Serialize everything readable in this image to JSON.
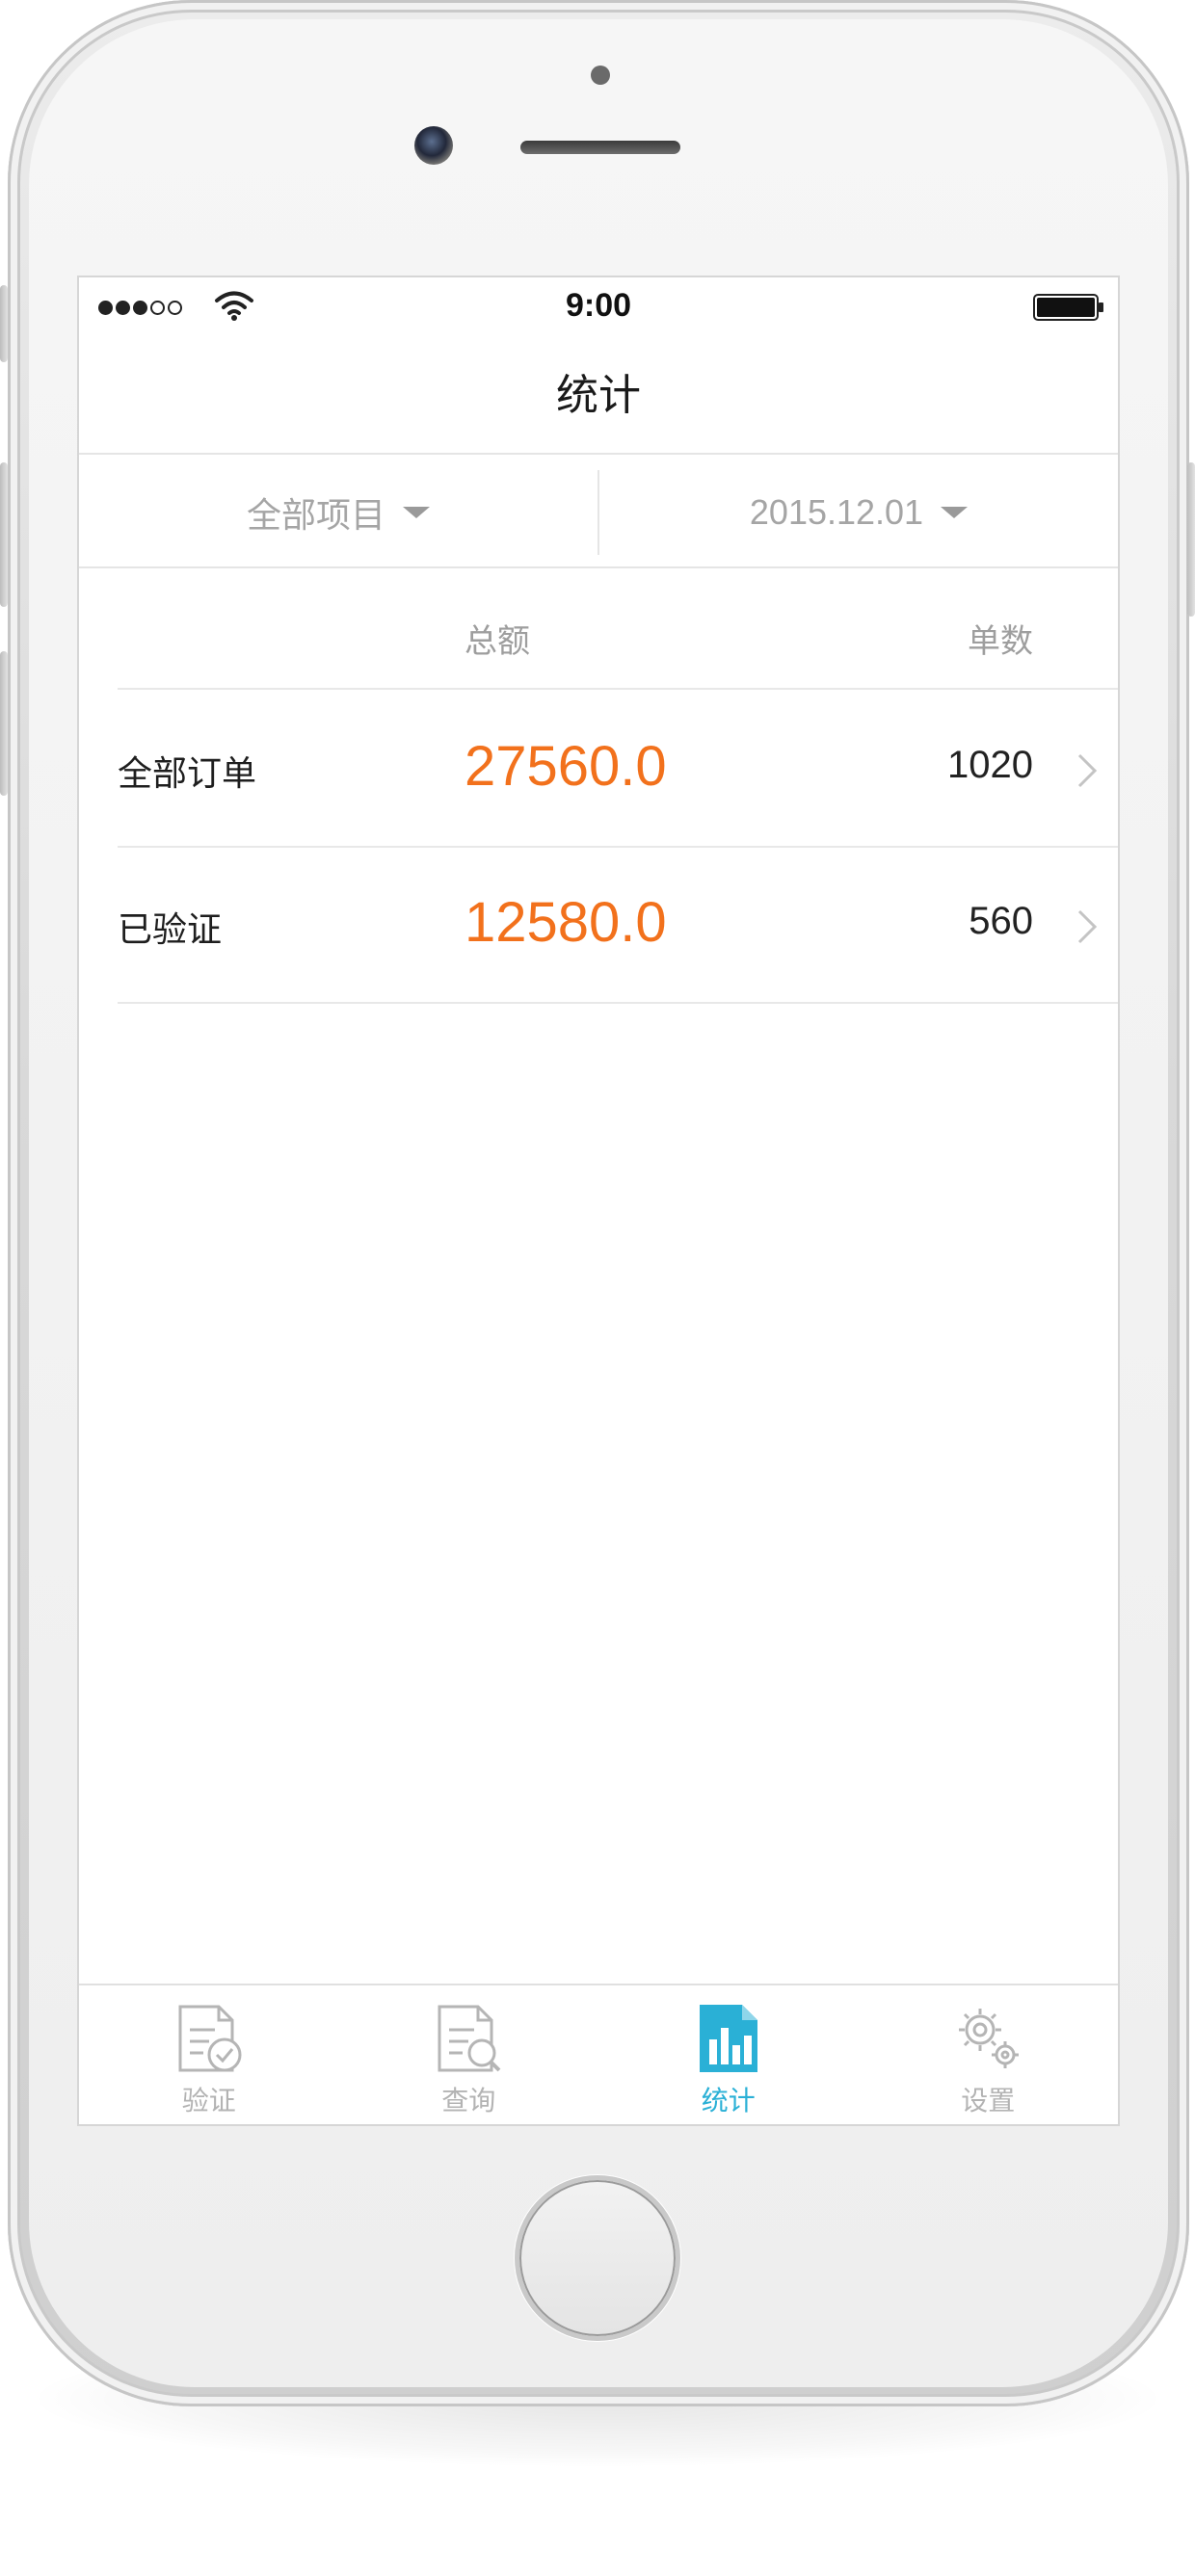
{
  "status_bar": {
    "time": "9:00",
    "signal_icon": "signal-dots-icon",
    "wifi_icon": "wifi-icon",
    "battery_icon": "battery-full-icon"
  },
  "nav": {
    "title": "统计"
  },
  "filters": {
    "project": {
      "value": "全部项目",
      "icon": "caret-down-icon"
    },
    "date": {
      "value": "2015.12.01",
      "icon": "caret-down-icon"
    }
  },
  "table": {
    "header_total": "总额",
    "header_count": "单数",
    "rows": [
      {
        "label": "全部订单",
        "amount": "27560.0",
        "count": "1020",
        "icon": "chevron-right-icon"
      },
      {
        "label": "已验证",
        "amount": "12580.0",
        "count": "560",
        "icon": "chevron-right-icon"
      }
    ]
  },
  "tab_bar": {
    "tabs": [
      {
        "label": "验证",
        "icon": "document-check-icon",
        "active": false
      },
      {
        "label": "查询",
        "icon": "document-search-icon",
        "active": false
      },
      {
        "label": "统计",
        "icon": "bar-chart-document-icon",
        "active": true
      },
      {
        "label": "设置",
        "icon": "gears-icon",
        "active": false
      }
    ]
  },
  "colors": {
    "amount": "#f2711c",
    "tab_active": "#2ab0d6",
    "tab_inactive": "#b3b3b3",
    "muted_text": "#a5a5a5"
  }
}
